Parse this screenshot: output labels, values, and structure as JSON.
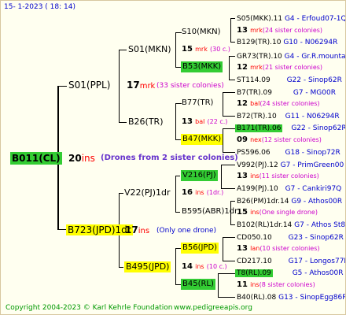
{
  "header": {
    "date": "15-  1-2023 (  18:  14)"
  },
  "root": {
    "name": "B011(CL)",
    "count": "20",
    "unit": "ins",
    "note": "(Drones from 2 sister colonies)"
  },
  "l1": {
    "top": {
      "name": "S01(PPL)",
      "count": "17",
      "unit": "mrk",
      "note": "(33 sister colonies)"
    },
    "bot": {
      "name": "B723(JPD)1dr",
      "count": "17",
      "unit": "ins",
      "note": "(Only one drone)"
    }
  },
  "l2": {
    "a": {
      "name": "S01(MKN)",
      "count": "15",
      "unit": "mrk",
      "note": "(30 c.)"
    },
    "b": {
      "name": "B26(TR)",
      "count": "13",
      "unit": "bal",
      "note": "(22 c.)"
    },
    "c": {
      "name": "V22(PJ)1dr",
      "count": "16",
      "unit": "ins",
      "note": "(1dr.)"
    },
    "d": {
      "name": "B495(JPD)",
      "count": "14",
      "unit": "ins",
      "note": "(10 c.)"
    }
  },
  "l3": {
    "a": {
      "name": "S10(MKN)",
      "count": "13",
      "unit": "mrk",
      "note": "(24 sister colonies)"
    },
    "b": {
      "name": "B53(MKK)",
      "count": "12",
      "unit": "mrk",
      "note": "(21 sister colonies)"
    },
    "c": {
      "name": "B77(TR)",
      "count": "12",
      "unit": "bal",
      "note": "(24 sister colonies)"
    },
    "d": {
      "name": "B47(MKK)",
      "count": "09",
      "unit": "nex",
      "note": "(12 sister colonies)"
    },
    "e": {
      "name": "V216(PJ)",
      "count": "13",
      "unit": "ins",
      "note": "(11 sister colonies)"
    },
    "f": {
      "name": "B595(ABR)1dr",
      "count": "15",
      "unit": "ins",
      "note": "(One single drone)"
    },
    "g": {
      "name": "B56(JPD)",
      "count": "13",
      "unit": "lan",
      "note": "(10 sister colonies)"
    },
    "h": {
      "name": "B45(RL)",
      "count": "11",
      "unit": "ins",
      "note": "(8 sister colonies)"
    }
  },
  "l4": [
    {
      "name": "S05(MKK).11",
      "ref": "G4 - Erfoud07-1Q"
    },
    {
      "name": "B129(TR).10",
      "ref": "G10 - N06294R"
    },
    {
      "name": "GR73(TR).10",
      "ref": "G4 - Gr.R.mounta"
    },
    {
      "name": "ST114.09",
      "ref": "G22 - Sinop62R"
    },
    {
      "name": "B7(TR).09",
      "ref": "G7 - MG00R"
    },
    {
      "name": "B72(TR).10",
      "ref": "G11 - N06294R"
    },
    {
      "name": "B171(TR).06",
      "ref": "G22 - Sinop62R"
    },
    {
      "name": "PS596.06",
      "ref": "G18 - Sinop72R"
    },
    {
      "name": "V992(PJ).12",
      "ref": "G7 - PrimGreen00"
    },
    {
      "name": "A199(PJ).10",
      "ref": "G7 - Cankiri97Q"
    },
    {
      "name": "B26(PM)1dr.14",
      "ref": "G9 - Athos00R"
    },
    {
      "name": "B102(RL)1dr.14",
      "ref": "G7 - Athos St80R"
    },
    {
      "name": "CD050.10",
      "ref": "G23 - Sinop62R"
    },
    {
      "name": "CD217.10",
      "ref": "G17 - Longos77R"
    },
    {
      "name": "T8(RL).09",
      "ref": "G5 - Athos00R"
    },
    {
      "name": "B40(RL).08",
      "ref": "G13 - SinopEgg86R"
    }
  ],
  "footer": {
    "copyright": "Copyright 2004-2023 © Karl Kehrle Foundation",
    "site": "www.pedigreeapis.org"
  },
  "colors": {
    "green": "#33cc33",
    "yellow": "#ffff00",
    "magenta": "#cc00cc",
    "red": "#ff0000",
    "blue": "#0000cc"
  }
}
